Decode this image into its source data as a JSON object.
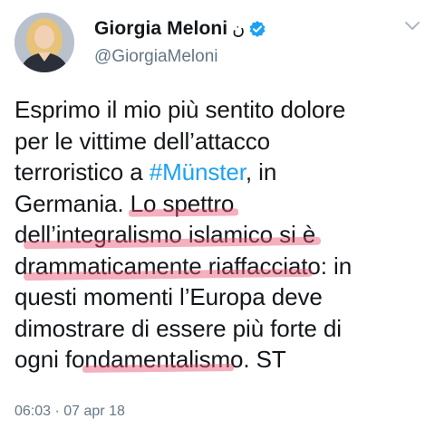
{
  "user": {
    "display_name": "Giorgia Meloni",
    "name_glyph": "ن",
    "handle": "@GiorgiaMeloni",
    "verified_icon": "verified-badge-icon"
  },
  "menu": {
    "icon": "chevron-down-icon"
  },
  "tweet": {
    "line1": "Esprimo il mio più sentito dolore",
    "line2": "per le vittime dell’attacco",
    "line3_before": "terroristico a ",
    "line3_hashtag": "#Münster",
    "line3_after": ", in",
    "line4_before": "Germania. ",
    "line4_highlight": "Lo spettro",
    "line5_before": "d",
    "line5_highlight": "ell’integralismo islamico si è",
    "line6_before": "d",
    "line6_highlight": "rammaticamente riaffacciat",
    "line6_after": "o: in",
    "line7": "questi momenti l’Europa deve",
    "line8": "dimostrare di essere più forte di",
    "line9_before": "ogni fo",
    "line9_highlight": "ndamentalism",
    "line9_after": "o. ST"
  },
  "meta": {
    "timestamp": "06:03 · 07 apr 18"
  },
  "colors": {
    "text": "#14171a",
    "secondary": "#657786",
    "link": "#1da1f2",
    "verified": "#1da1f2",
    "highlight": "#e6506e"
  }
}
